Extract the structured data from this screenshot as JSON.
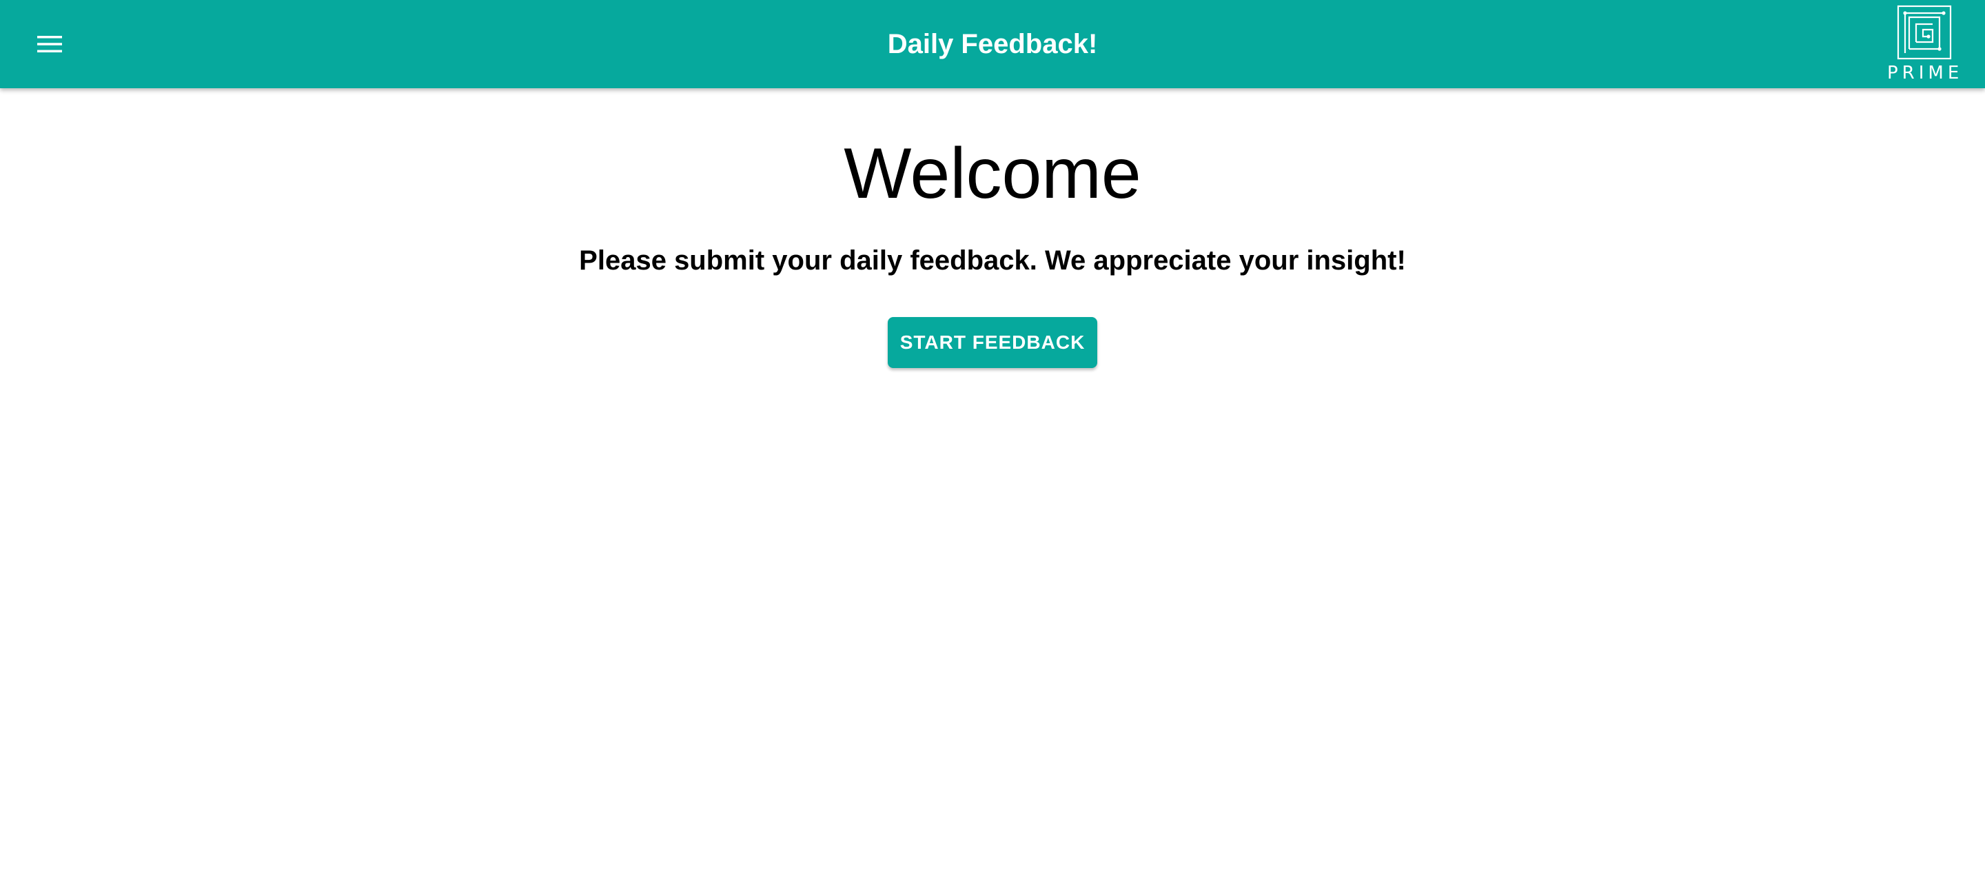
{
  "header": {
    "title": "Daily Feedback!",
    "menu_icon": "hamburger-menu-icon",
    "logo_text": "PRIME",
    "background_color": "#06a99d",
    "text_color": "#ffffff"
  },
  "main": {
    "heading": "Welcome",
    "subtitle": "Please submit your daily feedback. We appreciate your insight!",
    "start_button_label": "START FEEDBACK",
    "button_color": "#06a99d"
  }
}
